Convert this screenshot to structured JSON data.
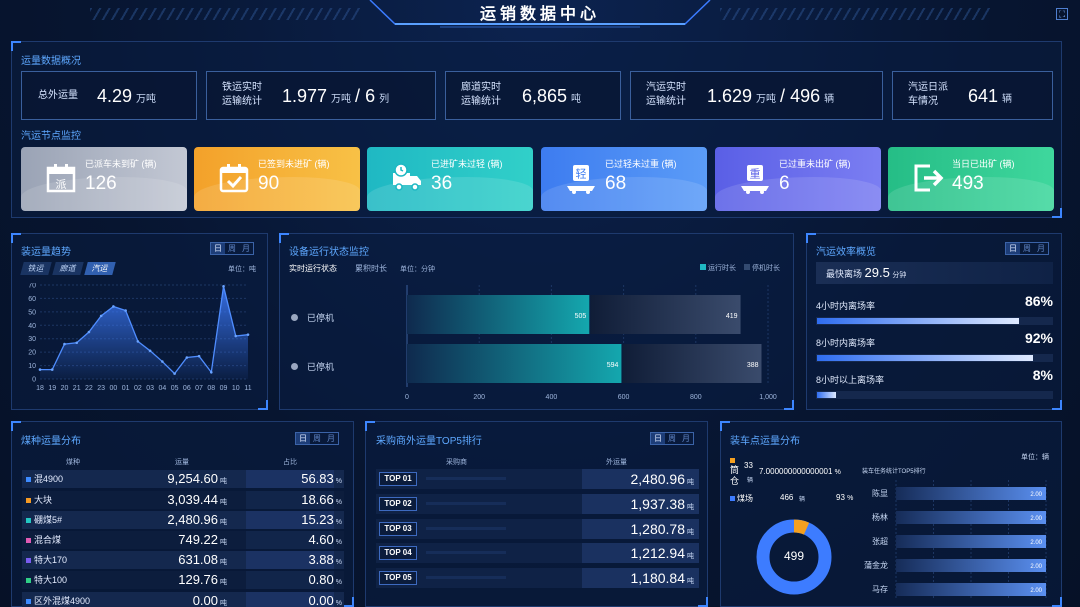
{
  "header": {
    "title": "运销数据中心"
  },
  "overview": {
    "title": "运量数据概况",
    "total": {
      "label": "总外运量",
      "value": "4.29",
      "unit": "万吨"
    },
    "rail": {
      "label1": "铁运实时",
      "label2": "运输统计",
      "value": "1.977",
      "unit": "万吨",
      "sep": "/",
      "value2": "6",
      "unit2": "列"
    },
    "corridor": {
      "label1": "廊道实时",
      "label2": "运输统计",
      "value": "6,865",
      "unit": "吨"
    },
    "truck": {
      "label1": "汽运实时",
      "label2": "运输统计",
      "value": "1.629",
      "unit": "万吨",
      "sep": "/",
      "value2": "496",
      "unit2": "辆"
    },
    "dispatch": {
      "label1": "汽运日派",
      "label2": "车情况",
      "value": "641",
      "unit": "辆"
    }
  },
  "nodes": {
    "title": "汽运节点监控",
    "items": [
      {
        "label": "已派车未到矿 (辆)",
        "value": "126",
        "icon": "calendar-pai-icon",
        "color_a": "#9aa3b5",
        "color_b": "#c3c8d4"
      },
      {
        "label": "已签到未进矿 (辆)",
        "value": "90",
        "icon": "calendar-check-icon",
        "color_a": "#f3a12a",
        "color_b": "#f8c146"
      },
      {
        "label": "已进矿未过轻 (辆)",
        "value": "36",
        "icon": "truck-clock-icon",
        "color_a": "#1fb8c3",
        "color_b": "#31d0c9"
      },
      {
        "label": "已过轻未过重 (辆)",
        "value": "68",
        "icon": "scale-light-icon",
        "color_a": "#3d7cf0",
        "color_b": "#5b9cf7"
      },
      {
        "label": "已过重未出矿 (辆)",
        "value": "6",
        "icon": "scale-heavy-icon",
        "color_a": "#5a5fe6",
        "color_b": "#7b7ef2"
      },
      {
        "label": "当日已出矿 (辆)",
        "value": "493",
        "icon": "exit-door-icon",
        "color_a": "#25bd86",
        "color_b": "#3fd79d"
      }
    ]
  },
  "tabs": [
    "日",
    "周",
    "月"
  ],
  "trend": {
    "title": "装运量趋势",
    "modes": [
      "铁运",
      "廊道",
      "汽运"
    ],
    "unit": "单位：吨"
  },
  "device": {
    "title": "设备运行状态监控",
    "sub1": "实时运行状态",
    "sub2": "累积时长",
    "unit": "单位：分钟",
    "legend_run": "运行时长",
    "legend_stop": "停机时长",
    "rows": [
      {
        "name": "已停机",
        "run": 505,
        "stop": 419
      },
      {
        "name": "已停机",
        "run": 594,
        "stop": 388
      }
    ],
    "ticks": [
      "0",
      "200",
      "400",
      "600",
      "800",
      "1,000"
    ]
  },
  "efficiency": {
    "title": "汽运效率概览",
    "fastest_label": "最快离场",
    "fastest_value": "29.5",
    "fastest_unit": "分钟",
    "rows": [
      {
        "label": "4小时内离场率",
        "value": "86%",
        "pct": 86
      },
      {
        "label": "8小时内离场率",
        "value": "92%",
        "pct": 92
      },
      {
        "label": "8小时以上离场率",
        "value": "8%",
        "pct": 8
      }
    ]
  },
  "coal": {
    "title": "煤种运量分布",
    "headers": [
      "煤种",
      "运量",
      "占比"
    ],
    "unit_t": "吨",
    "unit_p": "%",
    "rows": [
      {
        "name": "混4900",
        "vol": "9,254.60",
        "pct": "56.83",
        "color": "#3d8bff"
      },
      {
        "name": "大块",
        "vol": "3,039.44",
        "pct": "18.66",
        "color": "#f59a23"
      },
      {
        "name": "硼煤5#",
        "vol": "2,480.96",
        "pct": "15.23",
        "color": "#23c7c2"
      },
      {
        "name": "混合煤",
        "vol": "749.22",
        "pct": "4.60",
        "color": "#e05ab4"
      },
      {
        "name": "特大170",
        "vol": "631.08",
        "pct": "3.88",
        "color": "#7a5cf0"
      },
      {
        "name": "特大100",
        "vol": "129.76",
        "pct": "0.80",
        "color": "#2fcf87"
      },
      {
        "name": "区外混煤4900",
        "vol": "0.00",
        "pct": "0.00",
        "color": "#3d8bff"
      }
    ]
  },
  "top5": {
    "title": "采购商外运量TOP5排行",
    "headers": [
      "采购商",
      "外运量"
    ],
    "unit": "吨",
    "rows": [
      {
        "rank": "TOP 01",
        "vol": "2,480.96"
      },
      {
        "rank": "TOP 02",
        "vol": "1,937.38"
      },
      {
        "rank": "TOP 03",
        "vol": "1,280.78"
      },
      {
        "rank": "TOP 04",
        "vol": "1,212.94"
      },
      {
        "rank": "TOP 05",
        "vol": "1,180.84"
      }
    ]
  },
  "loading": {
    "title": "装车点运量分布",
    "unit": "单位：辆",
    "sub_title": "装车任务统计TOP5排行",
    "legend": [
      {
        "name1": "筒",
        "name2": "仓",
        "count": "33",
        "unit": "辆",
        "pct": "7.000000000000001",
        "pct_unit": "%",
        "color": "#f5a020"
      },
      {
        "name1": "煤场",
        "name2": "",
        "count": "466",
        "unit": "辆",
        "pct": "93",
        "pct_unit": "%",
        "color": "#3d7cff"
      }
    ],
    "donut_total": "499",
    "bars": [
      {
        "name": "陈显",
        "value": "2.00"
      },
      {
        "name": "杨林",
        "value": "2.00"
      },
      {
        "name": "张超",
        "value": "2.00"
      },
      {
        "name": "蒲金龙",
        "value": "2.00"
      },
      {
        "name": "马存",
        "value": "2.00"
      }
    ]
  },
  "chart_data": {
    "type": "area",
    "title": "装运量趋势",
    "x": [
      "18",
      "19",
      "20",
      "21",
      "22",
      "23",
      "00",
      "01",
      "02",
      "03",
      "04",
      "05",
      "06",
      "07",
      "08",
      "09",
      "10",
      "11"
    ],
    "series": [
      {
        "values": [
          7,
          7,
          26,
          27,
          35,
          47,
          54,
          51,
          28,
          21,
          13,
          4,
          16,
          17,
          5,
          69,
          32,
          33
        ]
      }
    ],
    "ylim": [
      0,
      70
    ],
    "yticks": [
      0,
      10,
      20,
      30,
      40,
      50,
      60,
      70
    ]
  }
}
